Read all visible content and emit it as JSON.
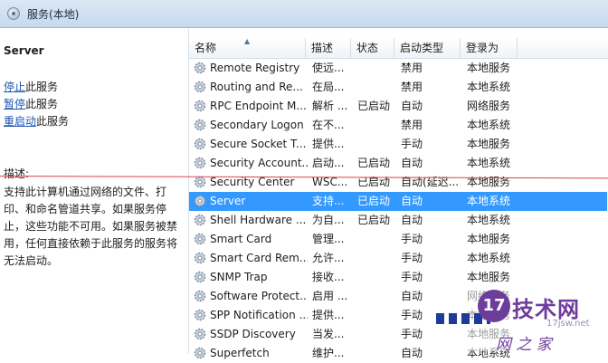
{
  "window": {
    "title": "服务(本地)"
  },
  "left_pane": {
    "service_name": "Server",
    "actions": [
      {
        "link": "停止",
        "suffix": "此服务"
      },
      {
        "link": "暂停",
        "suffix": "此服务"
      },
      {
        "link": "重启动",
        "suffix": "此服务"
      }
    ],
    "description_label": "描述:",
    "description_lines": [
      "支持此计算机通过网络的文件、打",
      "印、和命名管道共享。如果服务停",
      "止，这些功能不可用。如果服务被禁",
      "用，任何直接依赖于此服务的服务将",
      "无法启动。"
    ]
  },
  "columns": [
    "名称",
    "描述",
    "状态",
    "启动类型",
    "登录为"
  ],
  "services": [
    {
      "name": "Remote Registry",
      "desc": "使远...",
      "status": "",
      "startup": "禁用",
      "logon": "本地服务"
    },
    {
      "name": "Routing and Re...",
      "desc": "在局...",
      "status": "",
      "startup": "禁用",
      "logon": "本地系统"
    },
    {
      "name": "RPC Endpoint M...",
      "desc": "解析 ...",
      "status": "已启动",
      "startup": "自动",
      "logon": "网络服务"
    },
    {
      "name": "Secondary Logon",
      "desc": "在不...",
      "status": "",
      "startup": "禁用",
      "logon": "本地系统"
    },
    {
      "name": "Secure Socket T...",
      "desc": "提供...",
      "status": "",
      "startup": "手动",
      "logon": "本地服务"
    },
    {
      "name": "Security Account...",
      "desc": "启动...",
      "status": "已启动",
      "startup": "自动",
      "logon": "本地系统"
    },
    {
      "name": "Security Center",
      "desc": "WSC...",
      "status": "已启动",
      "startup": "自动(延迟...",
      "logon": "本地服务"
    },
    {
      "name": "Server",
      "desc": "支持...",
      "status": "已启动",
      "startup": "自动",
      "logon": "本地系统",
      "selected": true
    },
    {
      "name": "Shell Hardware ...",
      "desc": "为自...",
      "status": "已启动",
      "startup": "自动",
      "logon": "本地系统"
    },
    {
      "name": "Smart Card",
      "desc": "管理...",
      "status": "",
      "startup": "手动",
      "logon": "本地服务"
    },
    {
      "name": "Smart Card Rem...",
      "desc": "允许...",
      "status": "",
      "startup": "手动",
      "logon": "本地系统"
    },
    {
      "name": "SNMP Trap",
      "desc": "接收...",
      "status": "",
      "startup": "手动",
      "logon": "本地服务"
    },
    {
      "name": "Software Protect...",
      "desc": "启用 ...",
      "status": "",
      "startup": "自动",
      "logon": "网络服务"
    },
    {
      "name": "SPP Notification ...",
      "desc": "提供...",
      "status": "",
      "startup": "手动",
      "logon": "本地服务"
    },
    {
      "name": "SSDP Discovery",
      "desc": "当发...",
      "status": "",
      "startup": "手动",
      "logon": "本地服务"
    },
    {
      "name": "Superfetch",
      "desc": "维护...",
      "status": "",
      "startup": "自动",
      "logon": "本地系统"
    }
  ],
  "watermark": {
    "logo": "17",
    "title": "技术网",
    "url": "17jsw.net",
    "corner": "网 之 家"
  }
}
